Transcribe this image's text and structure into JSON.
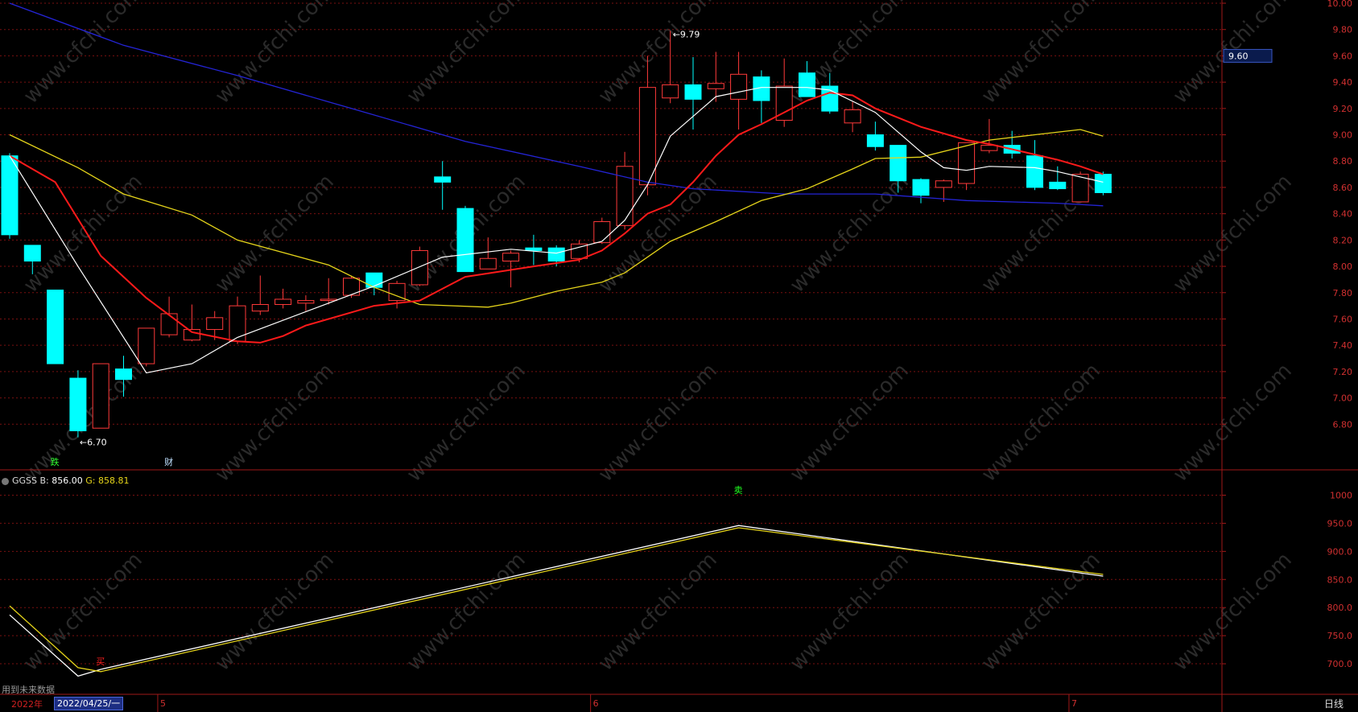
{
  "colors": {
    "background": "#000000",
    "up": "#ff3a3a",
    "down": "#00ffff",
    "ma5": "#ffffff",
    "ma10": "#ff1a1a",
    "ma20": "#e5d41a",
    "ma60": "#2424d6",
    "grid": "#7a1010",
    "axis_text": "#d03030"
  },
  "chart_data": [
    {
      "type": "candlestick",
      "y_ticks": [
        "10.00",
        "9.80",
        "9.60",
        "9.40",
        "9.20",
        "9.00",
        "8.80",
        "8.60",
        "8.40",
        "8.20",
        "8.00",
        "7.80",
        "7.60",
        "7.40",
        "7.20",
        "7.00",
        "6.80"
      ],
      "ylim": [
        6.6,
        10.0
      ],
      "current_price_label": "9.60",
      "high_annotation": "9.79",
      "low_annotation": "6.70",
      "markers": [
        {
          "text": "跌",
          "index": 2,
          "color": "#30ff30"
        },
        {
          "text": "财",
          "index": 7,
          "color": "#bfe0ff"
        }
      ],
      "candles": [
        {
          "o": 8.84,
          "c": 8.24,
          "h": 8.86,
          "l": 8.21
        },
        {
          "o": 8.16,
          "c": 8.04,
          "h": 8.16,
          "l": 7.94
        },
        {
          "o": 7.82,
          "c": 7.26,
          "h": 7.82,
          "l": 7.26
        },
        {
          "o": 7.15,
          "c": 6.75,
          "h": 7.21,
          "l": 6.7
        },
        {
          "o": 6.77,
          "c": 7.26,
          "h": 7.26,
          "l": 6.77
        },
        {
          "o": 7.22,
          "c": 7.14,
          "h": 7.32,
          "l": 7.01
        },
        {
          "o": 7.26,
          "c": 7.53,
          "h": 7.53,
          "l": 7.24
        },
        {
          "o": 7.48,
          "c": 7.64,
          "h": 7.77,
          "l": 7.46
        },
        {
          "o": 7.44,
          "c": 7.52,
          "h": 7.71,
          "l": 7.43
        },
        {
          "o": 7.52,
          "c": 7.61,
          "h": 7.66,
          "l": 7.44
        },
        {
          "o": 7.43,
          "c": 7.7,
          "h": 7.77,
          "l": 7.41
        },
        {
          "o": 7.66,
          "c": 7.71,
          "h": 7.93,
          "l": 7.63
        },
        {
          "o": 7.71,
          "c": 7.75,
          "h": 7.83,
          "l": 7.68
        },
        {
          "o": 7.72,
          "c": 7.74,
          "h": 7.78,
          "l": 7.66
        },
        {
          "o": 7.74,
          "c": 7.75,
          "h": 7.91,
          "l": 7.71
        },
        {
          "o": 7.78,
          "c": 7.91,
          "h": 7.93,
          "l": 7.76
        },
        {
          "o": 7.95,
          "c": 7.84,
          "h": 7.95,
          "l": 7.78
        },
        {
          "o": 7.74,
          "c": 7.87,
          "h": 7.89,
          "l": 7.68
        },
        {
          "o": 7.86,
          "c": 8.12,
          "h": 8.15,
          "l": 7.85
        },
        {
          "o": 8.68,
          "c": 8.64,
          "h": 8.8,
          "l": 8.43
        },
        {
          "o": 8.44,
          "c": 7.96,
          "h": 8.46,
          "l": 7.96
        },
        {
          "o": 7.98,
          "c": 8.06,
          "h": 8.22,
          "l": 7.98
        },
        {
          "o": 8.04,
          "c": 8.1,
          "h": 8.12,
          "l": 7.84
        },
        {
          "o": 8.14,
          "c": 8.12,
          "h": 8.24,
          "l": 8.01
        },
        {
          "o": 8.14,
          "c": 8.04,
          "h": 8.16,
          "l": 8.0
        },
        {
          "o": 8.06,
          "c": 8.17,
          "h": 8.2,
          "l": 8.03
        },
        {
          "o": 8.18,
          "c": 8.34,
          "h": 8.37,
          "l": 8.17
        },
        {
          "o": 8.31,
          "c": 8.76,
          "h": 8.87,
          "l": 8.28
        },
        {
          "o": 8.62,
          "c": 9.36,
          "h": 9.6,
          "l": 8.54
        },
        {
          "o": 9.28,
          "c": 9.38,
          "h": 9.79,
          "l": 9.24
        },
        {
          "o": 9.38,
          "c": 9.27,
          "h": 9.59,
          "l": 9.04
        },
        {
          "o": 9.35,
          "c": 9.39,
          "h": 9.63,
          "l": 9.25
        },
        {
          "o": 9.27,
          "c": 9.46,
          "h": 9.63,
          "l": 9.04
        },
        {
          "o": 9.44,
          "c": 9.26,
          "h": 9.49,
          "l": 9.09
        },
        {
          "o": 9.11,
          "c": 9.37,
          "h": 9.58,
          "l": 9.06
        },
        {
          "o": 9.47,
          "c": 9.29,
          "h": 9.56,
          "l": 9.29
        },
        {
          "o": 9.37,
          "c": 9.18,
          "h": 9.47,
          "l": 9.16
        },
        {
          "o": 9.09,
          "c": 9.19,
          "h": 9.25,
          "l": 9.02
        },
        {
          "o": 9.0,
          "c": 8.91,
          "h": 9.1,
          "l": 8.88
        },
        {
          "o": 8.92,
          "c": 8.65,
          "h": 8.92,
          "l": 8.56
        },
        {
          "o": 8.66,
          "c": 8.54,
          "h": 8.67,
          "l": 8.48
        },
        {
          "o": 8.6,
          "c": 8.65,
          "h": 8.66,
          "l": 8.49
        },
        {
          "o": 8.63,
          "c": 8.94,
          "h": 8.94,
          "l": 8.58
        },
        {
          "o": 8.88,
          "c": 8.92,
          "h": 9.12,
          "l": 8.86
        },
        {
          "o": 8.92,
          "c": 8.86,
          "h": 9.03,
          "l": 8.82
        },
        {
          "o": 8.84,
          "c": 8.6,
          "h": 8.96,
          "l": 8.58
        },
        {
          "o": 8.64,
          "c": 8.59,
          "h": 8.76,
          "l": 8.58
        },
        {
          "o": 8.49,
          "c": 8.7,
          "h": 8.72,
          "l": 8.49
        },
        {
          "o": 8.7,
          "c": 8.56,
          "h": 8.72,
          "l": 8.54
        }
      ],
      "ma5": [
        [
          0,
          8.84
        ],
        [
          3,
          8.0
        ],
        [
          6,
          7.19
        ],
        [
          8,
          7.26
        ],
        [
          10,
          7.46
        ],
        [
          14,
          7.72
        ],
        [
          16,
          7.85
        ],
        [
          19,
          8.07
        ],
        [
          22,
          8.13
        ],
        [
          24,
          8.1
        ],
        [
          26,
          8.19
        ],
        [
          27,
          8.35
        ],
        [
          28,
          8.62
        ],
        [
          29,
          8.99
        ],
        [
          31,
          9.29
        ],
        [
          33,
          9.36
        ],
        [
          35,
          9.36
        ],
        [
          36,
          9.34
        ],
        [
          38,
          9.17
        ],
        [
          40,
          8.87
        ],
        [
          41,
          8.75
        ],
        [
          42,
          8.73
        ],
        [
          43,
          8.76
        ],
        [
          45,
          8.75
        ],
        [
          46,
          8.72
        ],
        [
          47,
          8.68
        ],
        [
          48,
          8.64
        ]
      ],
      "ma10": [
        [
          0,
          8.84
        ],
        [
          2,
          8.64
        ],
        [
          4,
          8.08
        ],
        [
          6,
          7.76
        ],
        [
          8,
          7.5
        ],
        [
          10,
          7.43
        ],
        [
          11,
          7.42
        ],
        [
          12,
          7.47
        ],
        [
          13,
          7.55
        ],
        [
          15,
          7.65
        ],
        [
          16,
          7.7
        ],
        [
          18,
          7.74
        ],
        [
          19,
          7.83
        ],
        [
          20,
          7.92
        ],
        [
          23,
          8.0
        ],
        [
          25,
          8.05
        ],
        [
          26,
          8.12
        ],
        [
          27,
          8.25
        ],
        [
          28,
          8.4
        ],
        [
          29,
          8.47
        ],
        [
          30,
          8.64
        ],
        [
          31,
          8.84
        ],
        [
          32,
          9.0
        ],
        [
          33,
          9.08
        ],
        [
          34,
          9.17
        ],
        [
          35,
          9.26
        ],
        [
          36,
          9.32
        ],
        [
          37,
          9.3
        ],
        [
          38,
          9.2
        ],
        [
          40,
          9.06
        ],
        [
          42,
          8.96
        ],
        [
          43,
          8.93
        ],
        [
          44,
          8.89
        ],
        [
          46,
          8.81
        ],
        [
          47,
          8.76
        ],
        [
          48,
          8.7
        ]
      ],
      "ma20": [
        [
          0,
          9.0
        ],
        [
          3,
          8.75
        ],
        [
          5,
          8.55
        ],
        [
          8,
          8.39
        ],
        [
          10,
          8.2
        ],
        [
          14,
          8.01
        ],
        [
          16,
          7.84
        ],
        [
          18,
          7.71
        ],
        [
          21,
          7.69
        ],
        [
          22,
          7.72
        ],
        [
          24,
          7.81
        ],
        [
          26,
          7.88
        ],
        [
          27,
          7.95
        ],
        [
          29,
          8.19
        ],
        [
          31,
          8.34
        ],
        [
          33,
          8.5
        ],
        [
          35,
          8.59
        ],
        [
          37,
          8.74
        ],
        [
          38,
          8.82
        ],
        [
          40,
          8.83
        ],
        [
          43,
          8.96
        ],
        [
          45,
          9.0
        ],
        [
          47,
          9.04
        ],
        [
          48,
          8.99
        ]
      ],
      "ma60": [
        [
          0,
          10.0
        ],
        [
          5,
          9.68
        ],
        [
          10,
          9.45
        ],
        [
          15,
          9.2
        ],
        [
          20,
          8.95
        ],
        [
          25,
          8.76
        ],
        [
          28,
          8.64
        ],
        [
          30,
          8.59
        ],
        [
          34,
          8.55
        ],
        [
          38,
          8.55
        ],
        [
          42,
          8.5
        ],
        [
          46,
          8.48
        ],
        [
          48,
          8.46
        ]
      ]
    },
    {
      "type": "line",
      "indicator_name": "GGSS",
      "b_label": "B:",
      "b_value": "856.00",
      "g_label": "G:",
      "g_value": "858.81",
      "y_ticks": [
        "1000",
        "950.0",
        "900.0",
        "850.0",
        "800.0",
        "750.0",
        "700.0"
      ],
      "ylim": [
        670,
        1005
      ],
      "markers": [
        {
          "text": "买",
          "index": 4,
          "color": "#ff2020"
        },
        {
          "text": "卖",
          "index": 32,
          "color": "#20ff20"
        }
      ],
      "series": [
        {
          "key": "B",
          "color": "#ffffff",
          "points": [
            [
              0,
              787
            ],
            [
              3,
              678
            ],
            [
              4,
              690
            ],
            [
              32,
              946
            ],
            [
              48,
              856
            ]
          ]
        },
        {
          "key": "G",
          "color": "#e5d41a",
          "points": [
            [
              0,
              803
            ],
            [
              3,
              693
            ],
            [
              4,
              686
            ],
            [
              32,
              942
            ],
            [
              48,
              859
            ]
          ]
        }
      ]
    }
  ],
  "x_axis": {
    "year_label": "2022年",
    "cursor_date": "2022/04/25/一",
    "month_ticks": [
      {
        "label": "5",
        "index": 7
      },
      {
        "label": "6",
        "index": 26
      },
      {
        "label": "7",
        "index": 47
      }
    ],
    "period": "日线"
  },
  "footer_note": "用到未来数据",
  "watermark": "www.cfchi.com"
}
